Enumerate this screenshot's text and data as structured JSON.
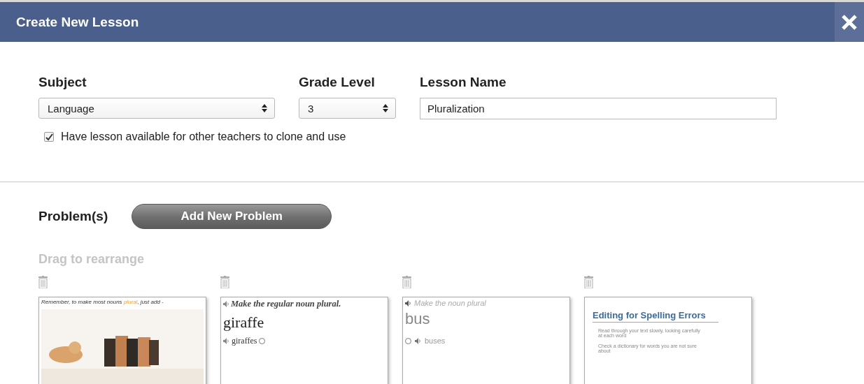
{
  "dialog": {
    "title": "Create New Lesson"
  },
  "fields": [
    {
      "kind": "select",
      "label": "Subject",
      "value": "Language"
    },
    {
      "kind": "select",
      "label": "Grade Level",
      "value": "3"
    },
    {
      "kind": "text",
      "label": "Lesson Name",
      "value": "Pluralization"
    }
  ],
  "share_option": {
    "label": "Have lesson available for other teachers to clone and use",
    "checked": true
  },
  "problems": {
    "heading": "Problem(s)",
    "add_button": "Add New Problem",
    "hint": "Drag to rearrange",
    "cards": [
      {
        "kind": "picture",
        "prompt": "Remember, to make most nouns **plural**, just add -"
      },
      {
        "kind": "serif_choice",
        "prompt": "Make the regular noun plural.",
        "word": "giraffe",
        "choices": [
          {
            "label": "giraffes",
            "selected": false
          }
        ]
      },
      {
        "kind": "sans_choice",
        "prompt": "Make the noun plural",
        "word": "bus",
        "choices": [
          {
            "label": "buses",
            "selected": false
          }
        ]
      },
      {
        "kind": "document",
        "title": "Editing for Spelling Errors",
        "bullets": [
          "Read through your text slowly, looking carefully at each word",
          "Check a dictionary for words you are not sure about"
        ]
      }
    ]
  }
}
